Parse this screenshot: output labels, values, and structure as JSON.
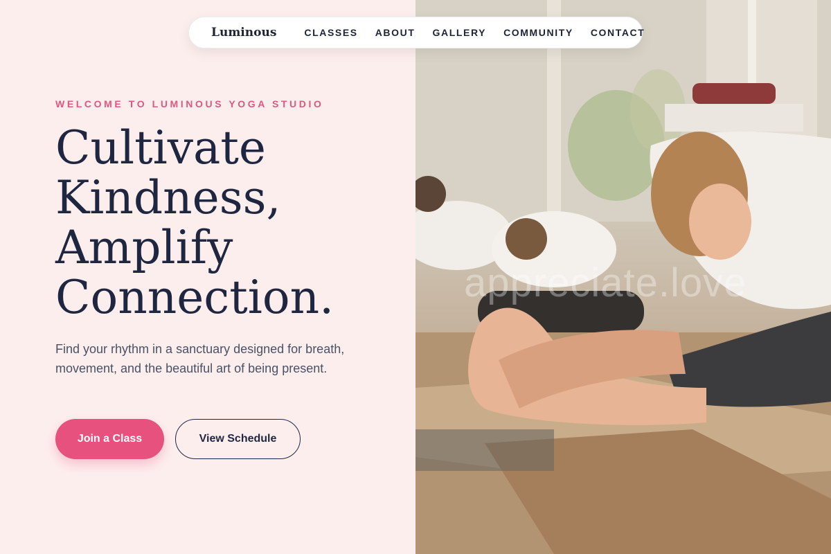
{
  "nav": {
    "logo": "Luminous",
    "links": [
      "CLASSES",
      "ABOUT",
      "GALLERY",
      "COMMUNITY",
      "CONTACT"
    ]
  },
  "hero": {
    "eyebrow": "WELCOME TO LUMINOUS YOGA STUDIO",
    "headline_lines": [
      "Cultivate",
      "Kindness,",
      "Amplify",
      "Connection."
    ],
    "subtext": "Find your rhythm in a sanctuary designed for breath, movement, and the beautiful art of being present.",
    "primary_button": "Join a Class",
    "secondary_button": "View Schedule"
  },
  "photo": {
    "subject": "yoga-class-forward-fold-photo",
    "watermark": "appreciate.love"
  },
  "colors": {
    "accent": "#e6517d",
    "eyebrow": "#e0577f",
    "background": "#fdeeee",
    "text_dark": "#1f2640"
  }
}
